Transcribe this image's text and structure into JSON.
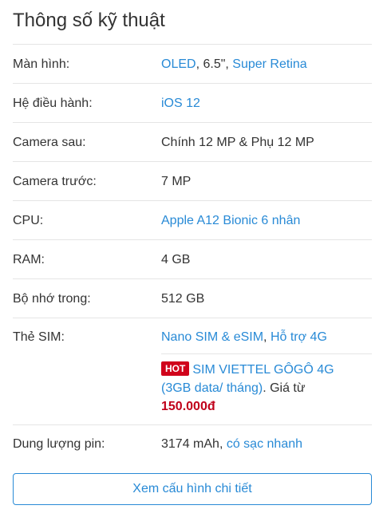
{
  "title": "Thông số kỹ thuật",
  "specs": [
    {
      "label": "Màn hình:",
      "parts": [
        {
          "text": "OLED",
          "link": true
        },
        {
          "text": ", 6.5\", ",
          "link": false
        },
        {
          "text": "Super Retina",
          "link": true
        }
      ]
    },
    {
      "label": "Hệ điều hành:",
      "parts": [
        {
          "text": "iOS 12",
          "link": true
        }
      ]
    },
    {
      "label": "Camera sau:",
      "parts": [
        {
          "text": "Chính 12 MP & Phụ 12 MP",
          "link": false
        }
      ]
    },
    {
      "label": "Camera trước:",
      "parts": [
        {
          "text": "7 MP",
          "link": false
        }
      ]
    },
    {
      "label": "CPU:",
      "parts": [
        {
          "text": "Apple A12 Bionic 6 nhân",
          "link": true
        }
      ]
    },
    {
      "label": "RAM:",
      "parts": [
        {
          "text": "4 GB",
          "link": false
        }
      ]
    },
    {
      "label": "Bộ nhớ trong:",
      "parts": [
        {
          "text": "512 GB",
          "link": false
        }
      ]
    },
    {
      "label": "Thẻ SIM:",
      "parts": [
        {
          "text": "Nano SIM & eSIM",
          "link": true
        },
        {
          "text": ", ",
          "link": false
        },
        {
          "text": "Hỗ trợ 4G",
          "link": true
        }
      ]
    },
    {
      "label": "Dung lượng pin:",
      "parts": [
        {
          "text": "3174 mAh",
          "link": false
        },
        {
          "text": ", ",
          "link": false
        },
        {
          "text": "có sạc nhanh",
          "link": true
        }
      ]
    }
  ],
  "sim_promo": {
    "badge": "HOT",
    "line1": "SIM VIETTEL GÔGÔ 4G",
    "line2": "(3GB data/ tháng)",
    "price_prefix": ". Giá từ",
    "price": "150.000đ"
  },
  "detail_button": "Xem cấu hình chi tiết",
  "colors": {
    "link": "#288ad6",
    "hot_badge": "#d0021b",
    "price": "#c0001a",
    "divider": "#e5e5e5"
  }
}
